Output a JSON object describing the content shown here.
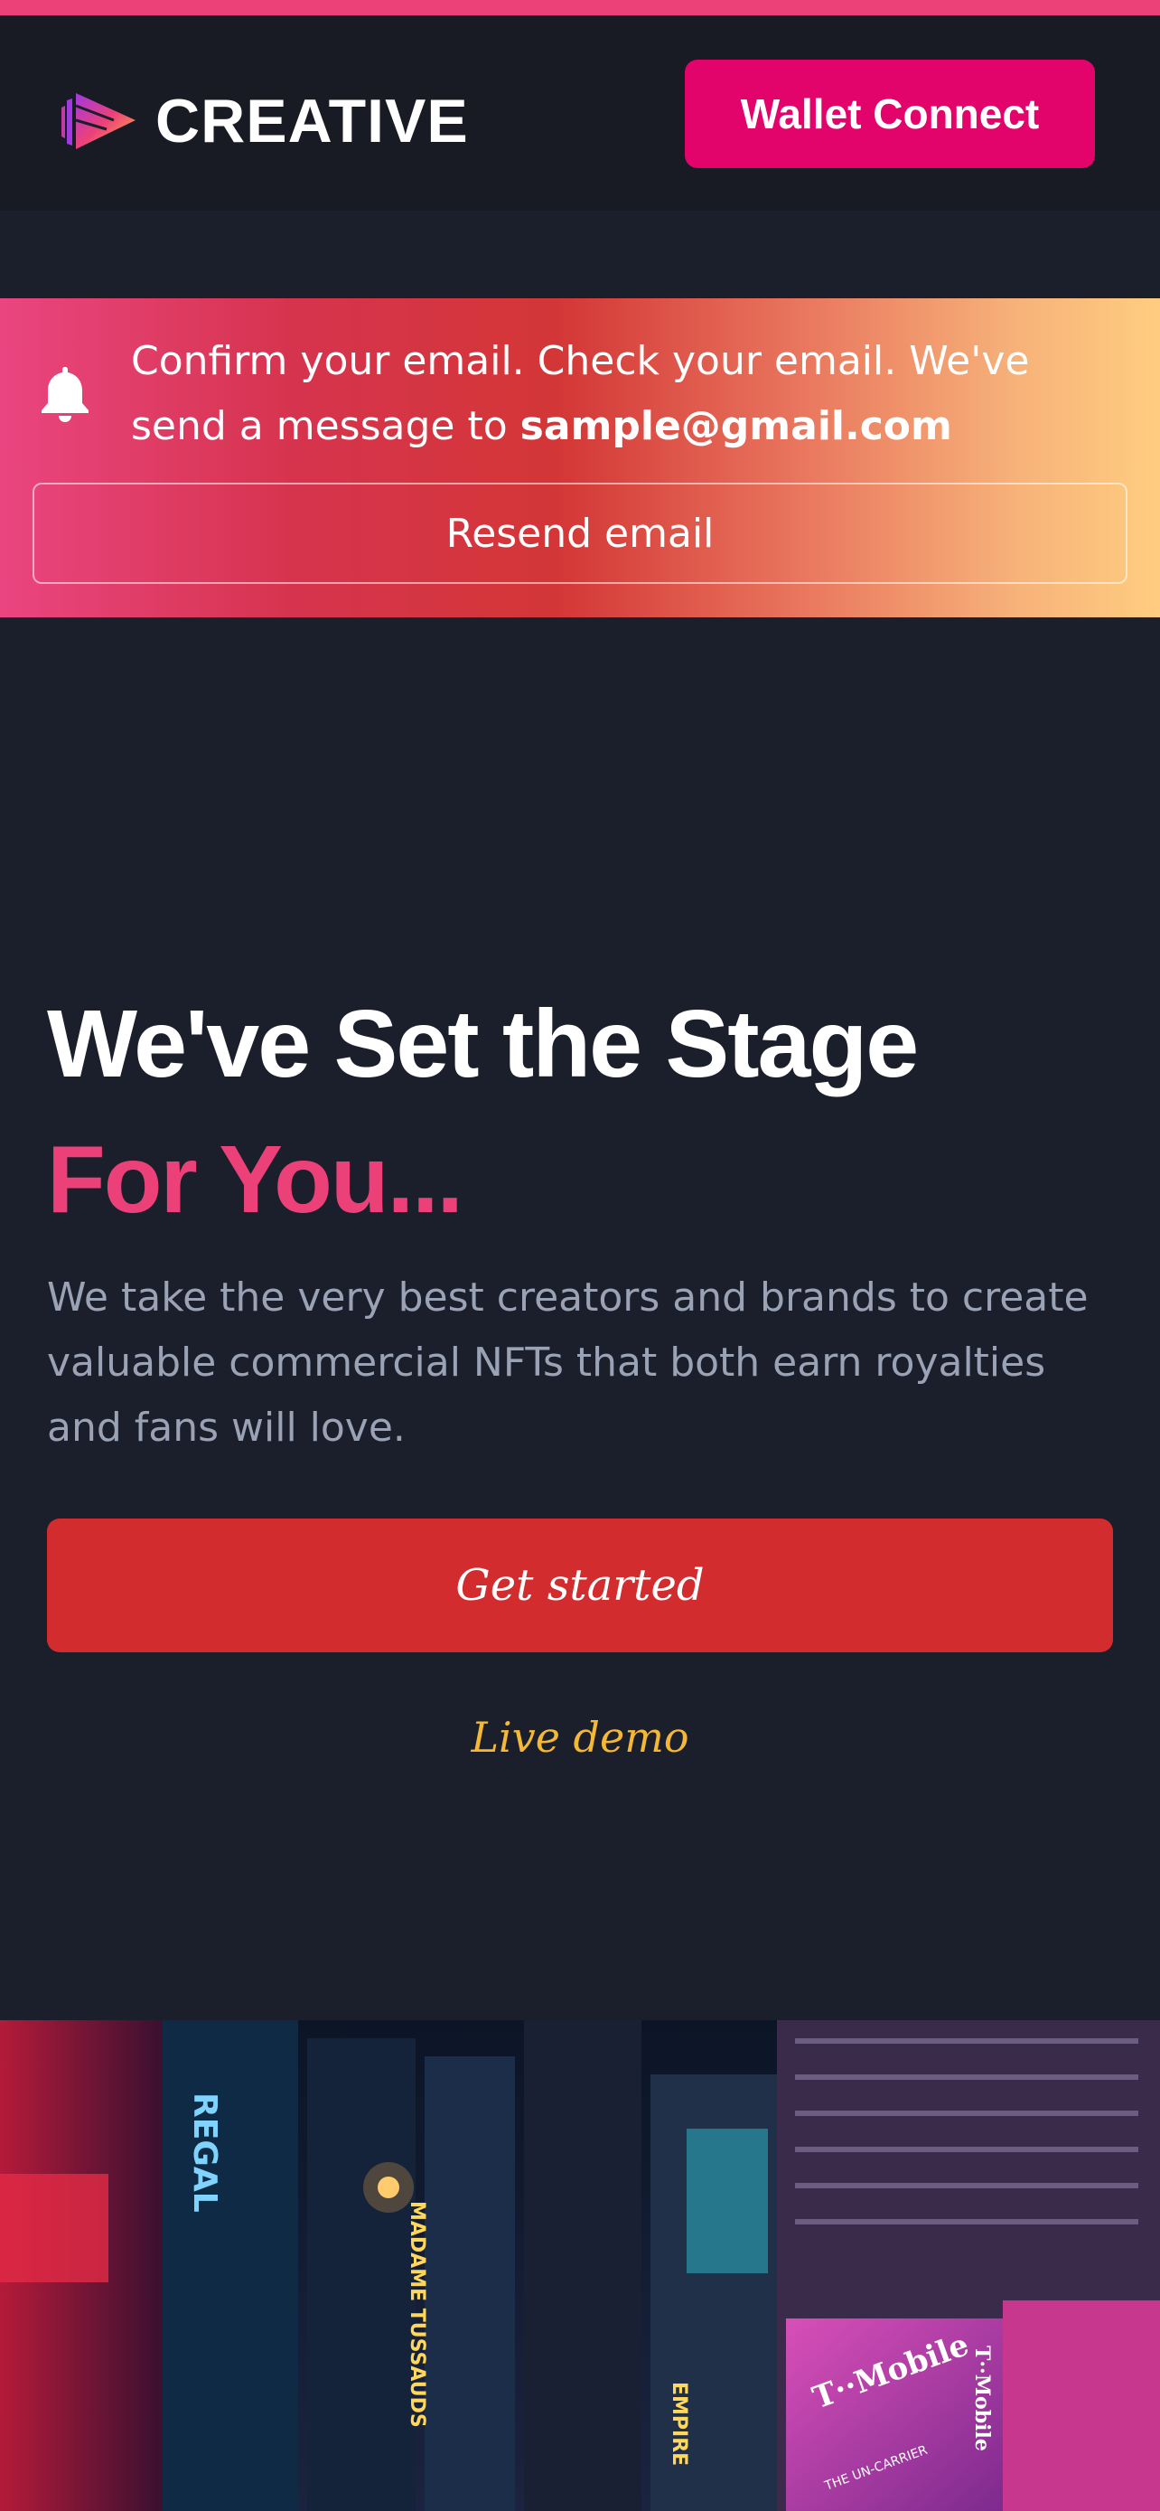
{
  "header": {
    "brand": "CREATIVE",
    "logo_icon": "play-stack-logo",
    "wallet_button": "Wallet Connect"
  },
  "banner": {
    "icon": "bell-icon",
    "message": "Confirm your email. Check your email. We've send a message to",
    "email": "sample@gmail.com",
    "resend_button": "Resend email"
  },
  "hero": {
    "title_line1": "We've Set the Stage",
    "title_line2": "For You...",
    "description": "We take the very best creators and brands to create valuable commercial NFTs that both earn royalties and fans will love.",
    "cta_button": "Get started",
    "demo_link": "Live demo"
  },
  "colors": {
    "accent_pink": "#ec4178",
    "wallet_button": "#e2046b",
    "cta_red": "#d22c2f",
    "demo_gold": "#f4b836",
    "background": "#1b1f2b"
  },
  "image": {
    "signs": [
      "REGAL",
      "MADAME TUSSAUDS",
      "EMPIRE",
      "T-Mobile",
      "T-Mobile",
      "THE UN-CARRIER"
    ]
  }
}
